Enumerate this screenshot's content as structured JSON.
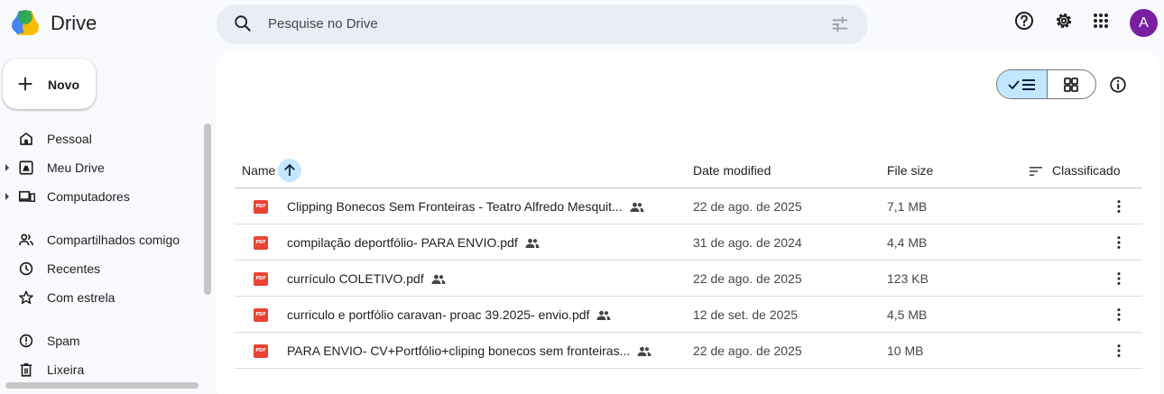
{
  "app": {
    "name": "Drive",
    "user_initial": "A"
  },
  "search": {
    "placeholder": "Pesquise no Drive"
  },
  "sidebar": {
    "new_label": "Novo",
    "items": [
      {
        "label": "Pessoal",
        "icon": "home-icon"
      },
      {
        "label": "Meu Drive",
        "icon": "my-drive-icon"
      },
      {
        "label": "Computadores",
        "icon": "computers-icon"
      },
      {
        "label": "Compartilhados comigo",
        "icon": "people-icon"
      },
      {
        "label": "Recentes",
        "icon": "clock-icon"
      },
      {
        "label": "Com estrela",
        "icon": "star-icon"
      },
      {
        "label": "Spam",
        "icon": "spam-icon"
      },
      {
        "label": "Lixeira",
        "icon": "trash-icon"
      }
    ]
  },
  "table": {
    "columns": {
      "name": "Name",
      "modified": "Date modified",
      "size": "File size",
      "sort": "Classificado"
    },
    "rows": [
      {
        "name": "Clipping Bonecos Sem Fronteiras - Teatro Alfredo Mesquit...",
        "modified": "22 de ago. de 2025",
        "size": "7,1 MB"
      },
      {
        "name": "compilação deportfólio- PARA ENVIO.pdf",
        "modified": "31 de ago. de 2024",
        "size": "4,4 MB"
      },
      {
        "name": "currículo COLETIVO.pdf",
        "modified": "22 de ago. de 2025",
        "size": "123 KB"
      },
      {
        "name": "curriculo e portfólio caravan- proac 39.2025- envio.pdf",
        "modified": "12 de set. de 2025",
        "size": "4,5 MB"
      },
      {
        "name": "PARA ENVIO- CV+Portfólio+cliping bonecos sem fronteiras...",
        "modified": "22 de ago. de 2025",
        "size": "10 MB"
      }
    ],
    "file_badge": "PDF"
  },
  "colors": {
    "accent": "#c2e7ff",
    "pdf": "#ea4335",
    "avatar": "#7b1fa2",
    "search_bg": "#e9eef6"
  }
}
